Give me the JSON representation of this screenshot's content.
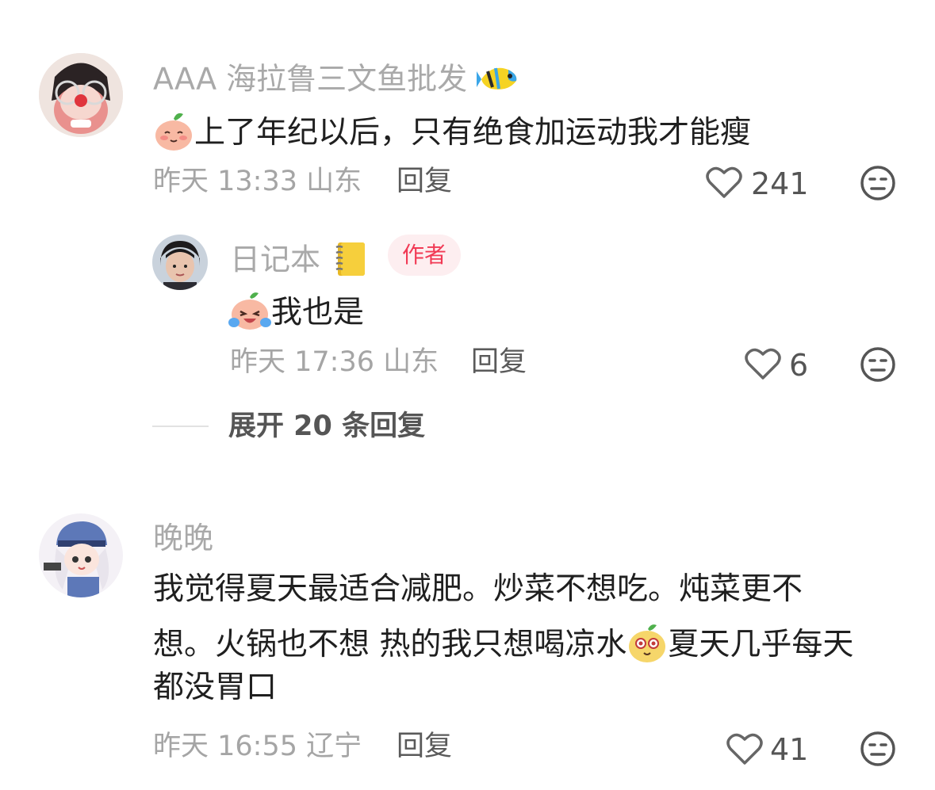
{
  "comments": [
    {
      "username": "AAA 海拉鲁三文鱼批发",
      "username_emoji": "tropical-fish-icon",
      "text": "上了年纪以后，只有绝食加运动我才能瘦",
      "text_emoji": "blush-face-icon",
      "time": "昨天 13:33",
      "location": "山东",
      "reply_label": "回复",
      "likes": "241",
      "replies": [
        {
          "username": "日记本",
          "username_emoji": "notebook-icon",
          "badge": "作者",
          "text": "我也是",
          "text_emoji": "laughing-crying-face-icon",
          "time": "昨天 17:36",
          "location": "山东",
          "reply_label": "回复",
          "likes": "6"
        }
      ],
      "expand_label": "展开 20 条回复"
    },
    {
      "username": "晚晚",
      "text_line1": "我觉得夏天最适合减肥。炒菜不想吃。炖菜更不",
      "text_line2a": "想。火锅也不想 热的我只想喝凉水",
      "text_line2b": "夏天几乎每天",
      "text_line3": "都没胃口",
      "text_emoji": "dizzy-face-icon",
      "time": "昨天 16:55",
      "location": "辽宁",
      "reply_label": "回复",
      "likes": "41"
    }
  ],
  "colors": {
    "username": "#a9a9a9",
    "text": "#1f1f1f",
    "meta": "#a5a5a5",
    "badge_bg": "#fdeef0",
    "badge_text": "#f13a55"
  }
}
